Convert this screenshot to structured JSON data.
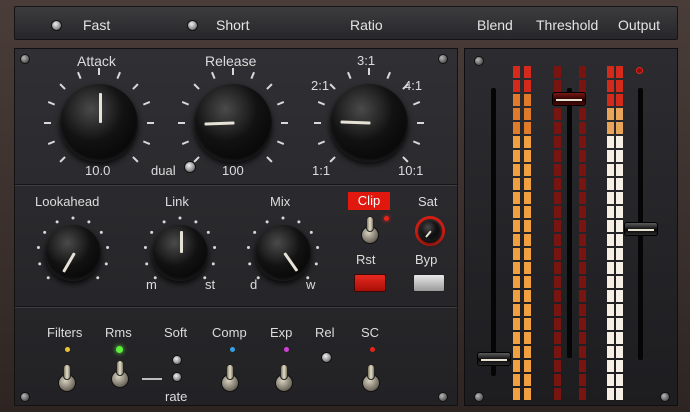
{
  "topbar": {
    "fast_label": "Fast",
    "short_label": "Short",
    "ratio_label": "Ratio",
    "blend_label": "Blend",
    "threshold_label": "Threshold",
    "output_label": "Output"
  },
  "knobs": {
    "attack": {
      "label": "Attack",
      "value": "10.0"
    },
    "release": {
      "label": "Release",
      "value": "100",
      "dual_label": "dual"
    },
    "ratio": {
      "top": "3:1",
      "upper_left": "2:1",
      "upper_right": "4:1",
      "lower_left": "1:1",
      "lower_right": "10:1"
    },
    "lookahead": {
      "label": "Lookahead"
    },
    "link": {
      "label": "Link",
      "left": "m",
      "right": "st"
    },
    "mix": {
      "label": "Mix",
      "left": "d",
      "right": "w"
    }
  },
  "clip": {
    "label": "Clip",
    "reset_label": "Rst"
  },
  "sat": {
    "label": "Sat",
    "bypass_label": "Byp"
  },
  "bottom": {
    "filters": "Filters",
    "rms": "Rms",
    "soft": "Soft",
    "rate": "rate",
    "comp": "Comp",
    "exp": "Exp",
    "rel": "Rel",
    "sc": "SC"
  },
  "colors": {
    "accent_red": "#e0180e",
    "led_green": "#5df03a",
    "led_yellow": "#e8c530",
    "led_blue": "#35a0e8",
    "led_magenta": "#d040d8",
    "led_red": "#e8241a"
  }
}
